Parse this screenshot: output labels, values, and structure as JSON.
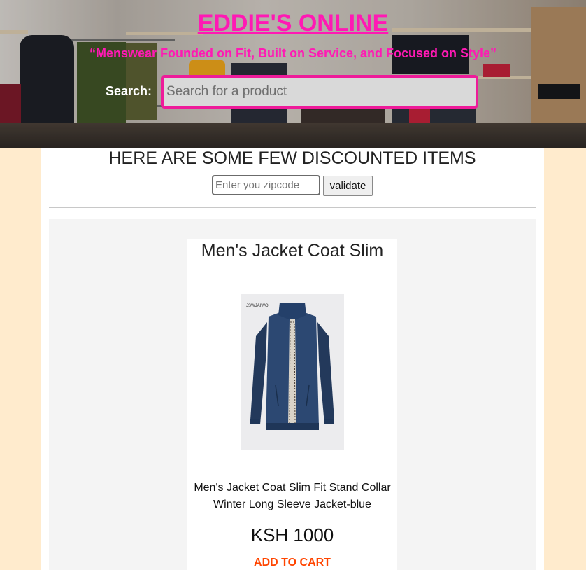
{
  "header": {
    "title": "EDDIE'S ONLINE",
    "tagline": "“Menswear Founded on Fit, Built on Service, and Focused on Style”",
    "search_label": "Search:",
    "search_placeholder": "Search for a product"
  },
  "discounts": {
    "heading": "HERE ARE SOME FEW DISCOUNTED ITEMS",
    "zip_placeholder": "Enter you zipcode",
    "validate_label": "validate"
  },
  "products": [
    {
      "name": "Men's Jacket Coat Slim",
      "image_brand": "JSWJAIWO",
      "description": "Men's Jacket Coat Slim Fit Stand Collar Winter Long Sleeve Jacket-blue",
      "price": "KSH 1000",
      "cta": "ADD TO CART"
    }
  ],
  "colors": {
    "page_bg": "#ffebcd",
    "brand_pink": "#ff19b4",
    "cta_orange": "#ff4500",
    "search_border": "#ee1b9a"
  }
}
